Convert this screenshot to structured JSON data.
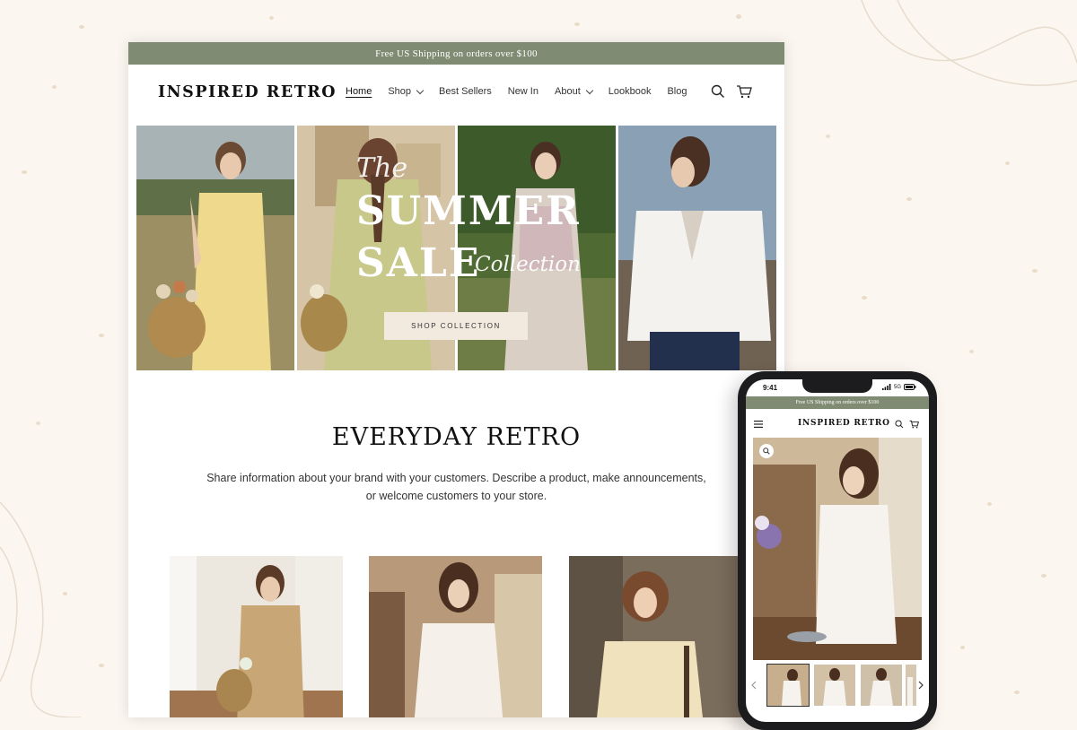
{
  "desktop": {
    "announcement": "Free US Shipping on orders over $100",
    "logo": "INSPIRED RETRO",
    "nav": [
      {
        "label": "Home",
        "active": true,
        "dropdown": false
      },
      {
        "label": "Shop",
        "active": false,
        "dropdown": true
      },
      {
        "label": "Best Sellers",
        "active": false,
        "dropdown": false
      },
      {
        "label": "New In",
        "active": false,
        "dropdown": false
      },
      {
        "label": "About",
        "active": false,
        "dropdown": true
      },
      {
        "label": "Lookbook",
        "active": false,
        "dropdown": false
      },
      {
        "label": "Blog",
        "active": false,
        "dropdown": false
      }
    ],
    "header_icons": [
      "search-icon",
      "cart-icon"
    ],
    "hero": {
      "the": "The",
      "line1": "SUMMER",
      "line2": "SALE",
      "script": "Collection",
      "button": "SHOP COLLECTION"
    },
    "section": {
      "title": "EVERYDAY RETRO",
      "text_line1": "Share information about your brand with your customers. Describe a product, make announcements,",
      "text_line2": "or welcome customers to your store."
    }
  },
  "mobile": {
    "time": "9:41",
    "network": "5G",
    "announcement": "Free US Shipping on orders over $100",
    "logo": "INSPIRED RETRO",
    "icons": [
      "menu-icon",
      "search-icon",
      "cart-icon",
      "zoom-icon",
      "chevron-left-icon",
      "chevron-right-icon"
    ]
  },
  "colors": {
    "announcement_bg": "#7f8b72",
    "page_bg": "#fcf6f0",
    "button_bg": "#f2e9df"
  }
}
